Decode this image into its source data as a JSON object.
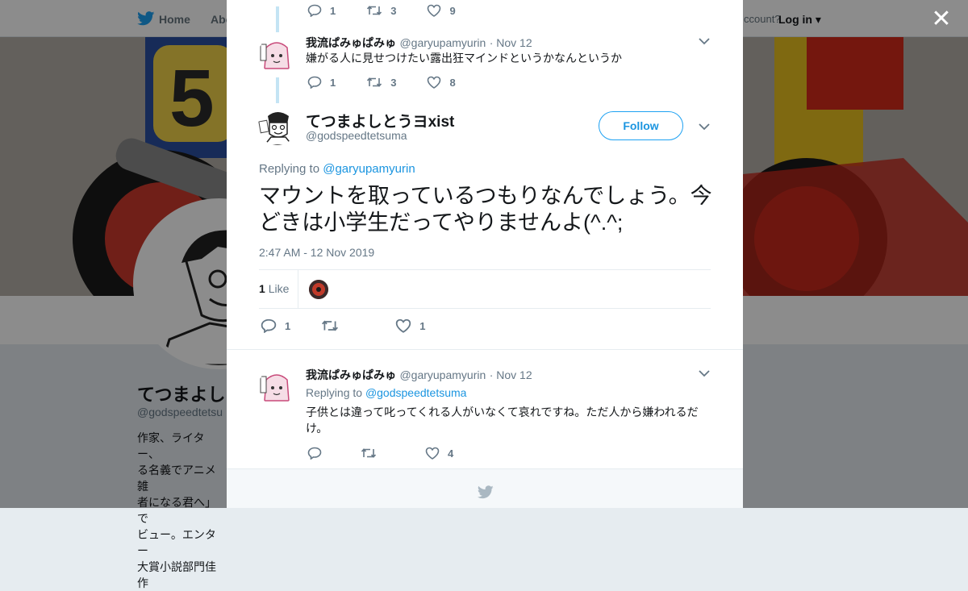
{
  "nav": {
    "home_label": "Home",
    "about_label": "Abo",
    "account_text": "ccount?",
    "login_label": "Log in"
  },
  "profile": {
    "name": "てつまよし",
    "handle": "@godspeedtetsu",
    "bio_lines": [
      "作家、ライター、",
      "る名義でアニメ雑",
      "者になる君へ」で",
      "ビュー。エンター",
      "大賞小説部門佳作"
    ]
  },
  "thread": {
    "top_actions": {
      "replies": "1",
      "retweets": "3",
      "likes": "9"
    },
    "tweet1": {
      "name": "我流ぱみゅぱみゅ",
      "handle": "@garyupamyurin",
      "date": "· Nov 12",
      "text": "嫌がる人に見せつけたい露出狂マインドというかなんというか",
      "replies": "1",
      "retweets": "3",
      "likes": "8"
    },
    "main": {
      "name": "てつまよしとうヨxist",
      "handle": "@godspeedtetsuma",
      "follow_label": "Follow",
      "replying_prefix": "Replying to",
      "replying_to": "@garyupamyurin",
      "text": "マウントを取っているつもりなんでしょう。今どきは小学生だってやりませんよ(^.^;",
      "timestamp": "2:47 AM - 12 Nov 2019",
      "like_count": "1",
      "like_label": "Like",
      "replies": "1",
      "likes": "1"
    },
    "reply": {
      "name": "我流ぱみゅぱみゅ",
      "handle": "@garyupamyurin",
      "date": "· Nov 12",
      "replying_prefix": "Replying to",
      "replying_to": "@godspeedtetsuma",
      "text": "子供とは違って叱ってくれる人がいなくて哀れですね。ただ人から嫌われるだけ。",
      "likes": "4"
    }
  },
  "colors": {
    "accent": "#1da1f2",
    "link": "#1b95e0",
    "muted": "#657786",
    "thread_line": "#c4e4f4"
  },
  "icons": [
    "twitter-bird-icon",
    "close-icon",
    "reply-icon",
    "retweet-icon",
    "like-icon",
    "chevron-down-icon"
  ]
}
